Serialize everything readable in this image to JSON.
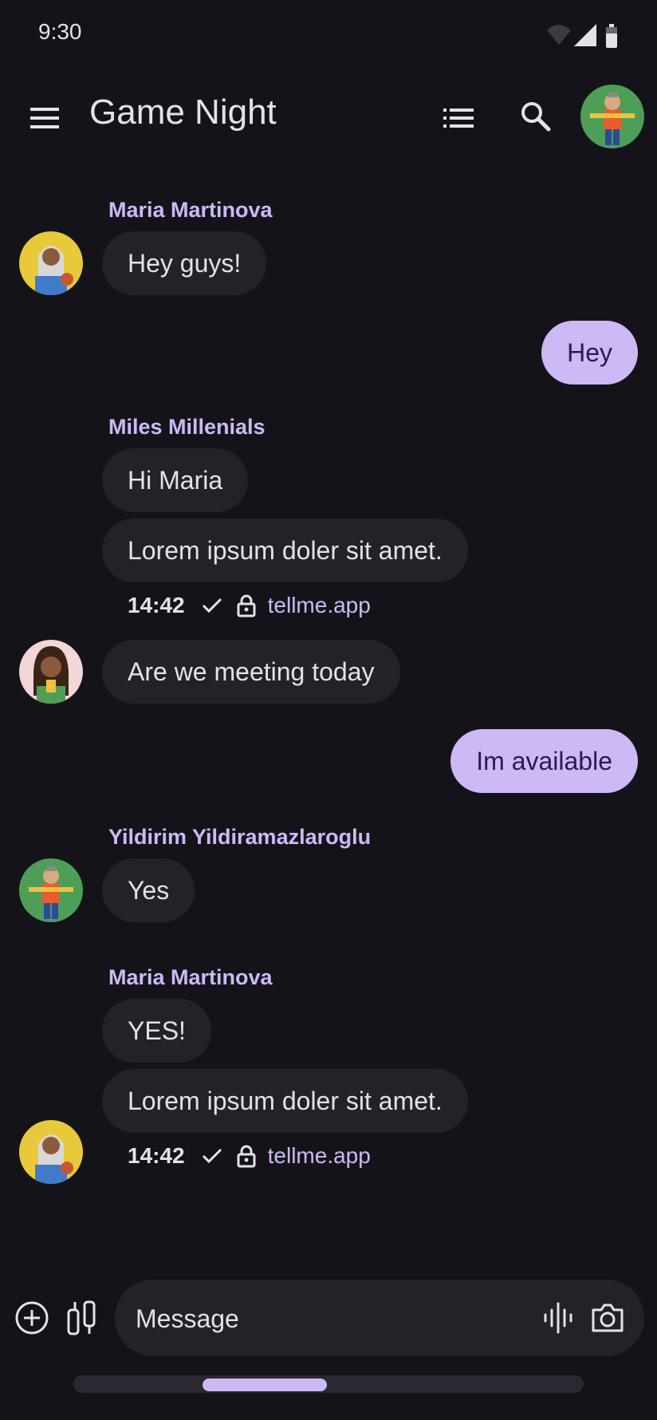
{
  "status_bar": {
    "time": "9:30"
  },
  "app_bar": {
    "title": "Game Night"
  },
  "messages": {
    "g1": {
      "sender": "Maria Martinova",
      "bubble1": "Hey guys!"
    },
    "out1": {
      "text": "Hey"
    },
    "g2": {
      "sender": "Miles Millenials",
      "bubble1": "Hi Maria",
      "bubble2": "Lorem ipsum doler sit amet.",
      "time": "14:42",
      "link": "tellme.app"
    },
    "g3": {
      "bubble1": "Are we meeting today"
    },
    "out2": {
      "text": "Im available"
    },
    "g4": {
      "sender": "Yildirim Yildiramazlaroglu",
      "bubble1": "Yes"
    },
    "g5": {
      "sender": "Maria Martinova",
      "bubble1": "YES!",
      "bubble2": "Lorem ipsum doler sit amet.",
      "time": "14:42",
      "link": "tellme.app"
    }
  },
  "composer": {
    "placeholder": "Message"
  },
  "colors": {
    "background": "#15131a",
    "bubble_incoming": "#242229",
    "bubble_outgoing": "#cdb9f5",
    "accent": "#cdb9f5"
  }
}
